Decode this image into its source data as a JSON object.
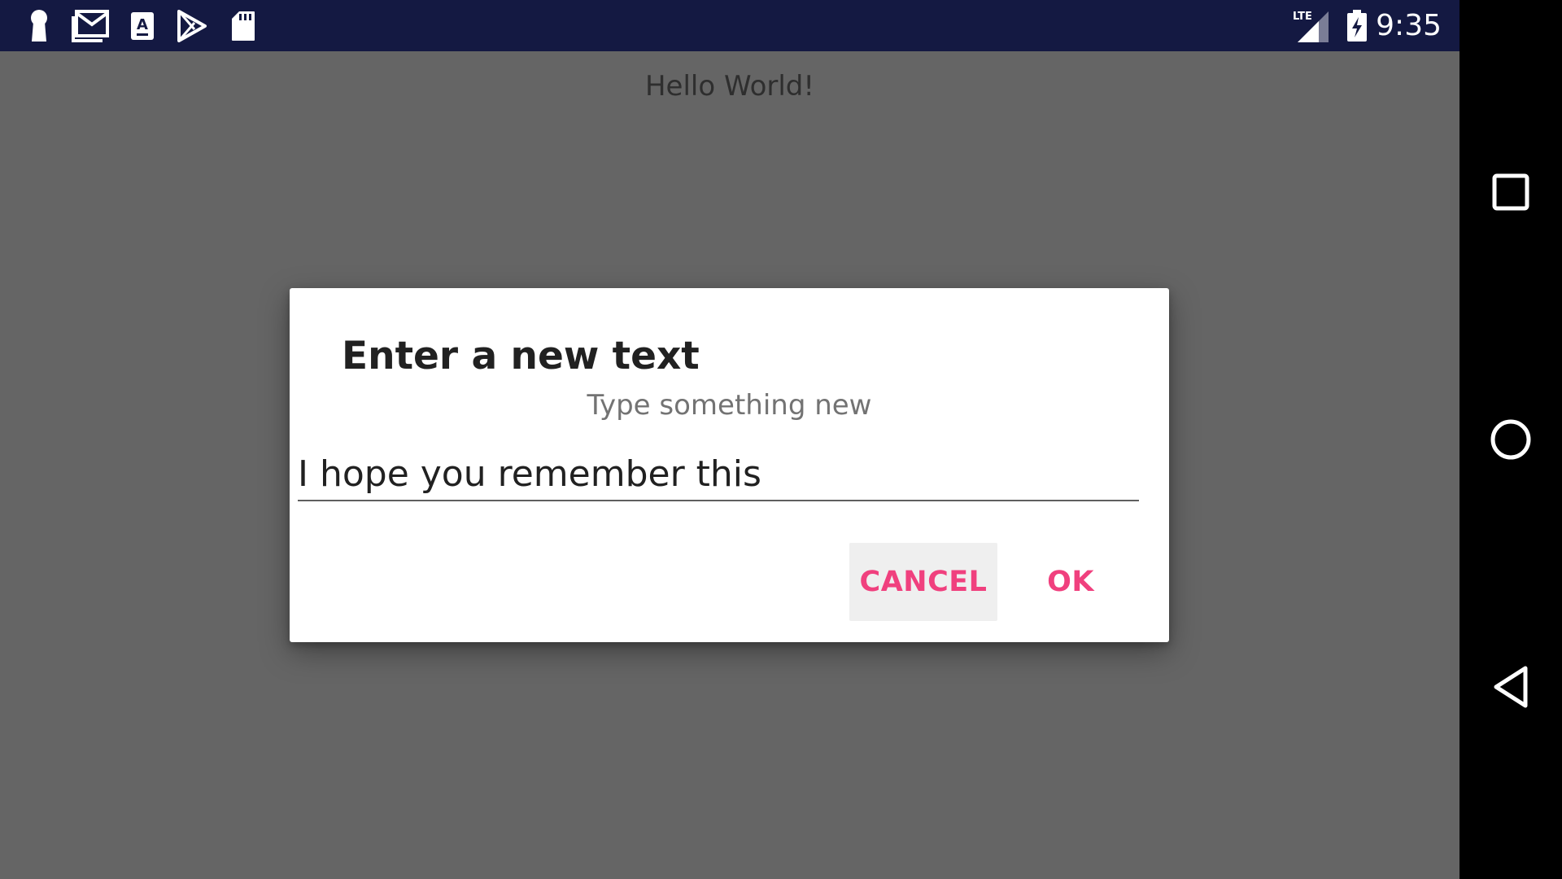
{
  "status_bar": {
    "time": "9:35",
    "network_label": "LTE",
    "icons": [
      "keyhole-notification-icon",
      "gmail-icon",
      "app-store-a-icon",
      "play-store-icon",
      "sd-card-icon",
      "lte-signal-icon",
      "battery-charging-icon"
    ],
    "background_color": "#141942"
  },
  "app": {
    "hello_text": "Hello World!",
    "background_color": "#656565"
  },
  "dialog": {
    "title": "Enter a new text",
    "message": "Type something new",
    "input_value": "I hope you remember this",
    "cancel_label": "CANCEL",
    "ok_label": "OK",
    "accent_color": "#f0407e"
  },
  "nav_bar": {
    "buttons": [
      "recents-square-icon",
      "home-circle-icon",
      "back-triangle-icon"
    ]
  }
}
